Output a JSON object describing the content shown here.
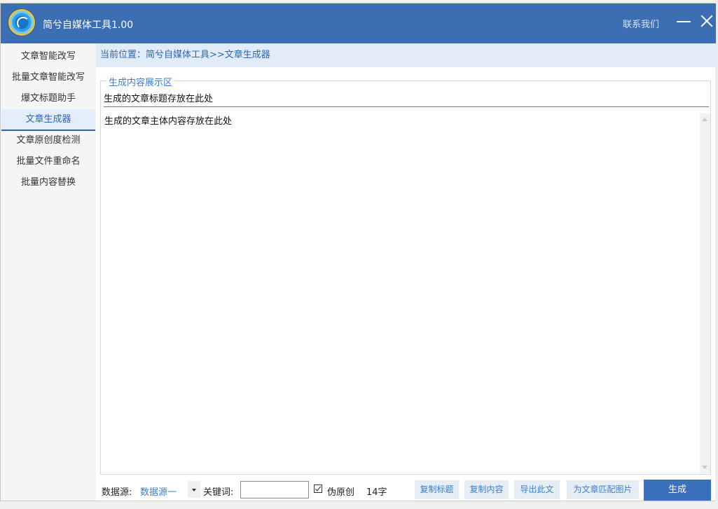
{
  "app": {
    "title": "简兮自媒体工具1.00",
    "contact_label": "联系我们"
  },
  "sidebar": {
    "items": [
      {
        "label": "文章智能改写"
      },
      {
        "label": "批量文章智能改写"
      },
      {
        "label": "爆文标题助手"
      },
      {
        "label": "文章生成器",
        "active": true
      },
      {
        "label": "文章原创度检测"
      },
      {
        "label": "批量文件重命名"
      },
      {
        "label": "批量内容替换"
      }
    ]
  },
  "breadcrumb": {
    "text": "当前位置：简兮自媒体工具>>文章生成器"
  },
  "display": {
    "group_label": "生成内容展示区",
    "title_placeholder": "生成的文章标题存放在此处",
    "content_placeholder": "生成的文章主体内容存放在此处"
  },
  "controls": {
    "datasource_label": "数据源:",
    "datasource_value": "数据源一",
    "keyword_label": "关键词:",
    "keyword_value": "",
    "pseudo_original_label": "伪原创",
    "pseudo_original_checked": true,
    "char_count": "14字",
    "copy_title": "复制标题",
    "copy_content": "复制内容",
    "export": "导出此文",
    "match_image": "为文章匹配图片",
    "generate": "生成"
  },
  "colors": {
    "titlebar": "#3c6eb4",
    "accent": "#3f7ec9",
    "primary_button": "#3b70be"
  },
  "icons": {
    "app_logo": "app-logo-icon",
    "minimize": "minimize-icon",
    "close": "close-icon",
    "dropdown": "chevron-down-icon",
    "checkbox": "checkbox-checked-icon"
  }
}
